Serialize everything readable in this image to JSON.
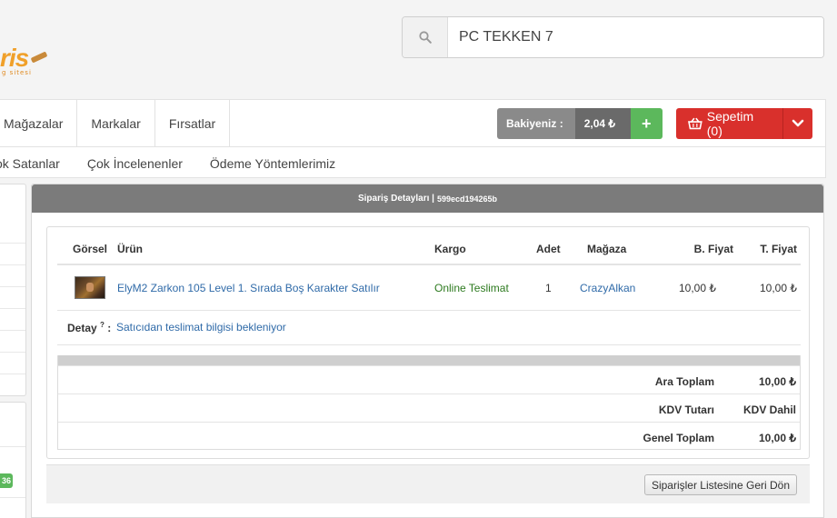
{
  "logo": {
    "text": "ris",
    "subtext": "g sitesi"
  },
  "search": {
    "value": "PC TEKKEN 7",
    "icon": "search-icon"
  },
  "nav": {
    "top_items": [
      "Mağazalar",
      "Markalar",
      "Fırsatlar"
    ],
    "bottom_items": [
      "ok Satanlar",
      "Çok İncelenenler",
      "Ödeme Yöntemlerimiz"
    ]
  },
  "balance": {
    "label": "Bakiyeniz :",
    "value": "2,04 ₺",
    "add": "+"
  },
  "cart": {
    "label": "Sepetim (0)",
    "icon": "basket-icon",
    "color": "#d9302c"
  },
  "left_sidebar": {
    "badge": "36"
  },
  "order": {
    "header_title": "Sipariş Detayları |",
    "order_id": "599ecd194265b",
    "columns": {
      "image": "Görsel",
      "product": "Ürün",
      "shipping": "Kargo",
      "qty": "Adet",
      "store": "Mağaza",
      "unit_price": "B. Fiyat",
      "total_price": "T. Fiyat"
    },
    "items": [
      {
        "product": "ElyM2 Zarkon 105 Level 1. Sırada Boş Karakter Satılır",
        "shipping": "Online Teslimat",
        "qty": "1",
        "store": "CrazyAlkan",
        "unit_price": "10,00 ₺",
        "total_price": "10,00 ₺"
      }
    ],
    "detail_label": "Detay",
    "detail_sup": "?",
    "detail_colon": ":",
    "detail_text": "Satıcıdan teslimat bilgisi bekleniyor",
    "summary": [
      {
        "label": "Ara Toplam",
        "value": "10,00 ₺"
      },
      {
        "label": "KDV Tutarı",
        "value": "KDV Dahil"
      },
      {
        "label": "Genel Toplam",
        "value": "10,00 ₺"
      }
    ],
    "back_button": "Siparişler Listesine Geri Dön"
  },
  "colors": {
    "accent_green": "#5cb85c",
    "link": "#2f6aa8",
    "shipping_green": "#2d7a1f",
    "header_grey": "#7b7b7b"
  }
}
